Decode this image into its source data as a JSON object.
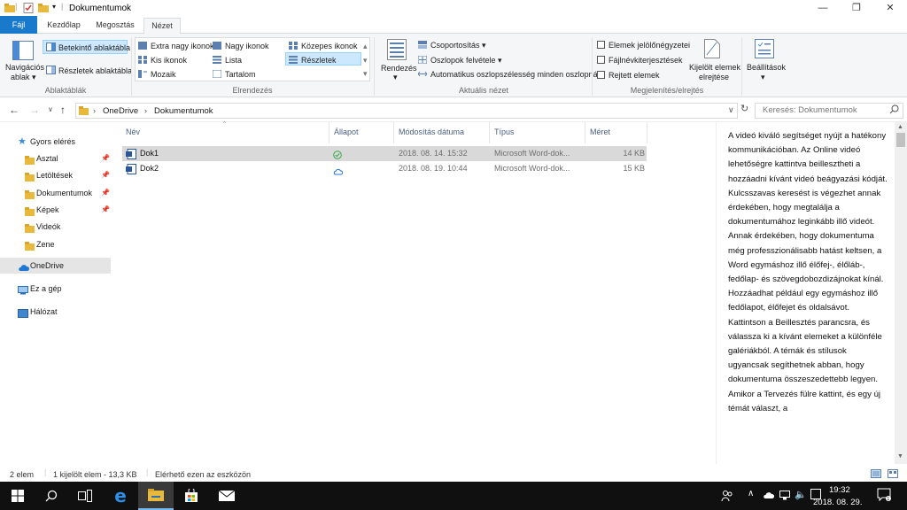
{
  "window": {
    "title": "Dokumentumok",
    "controls": [
      "—",
      "❐",
      "✕"
    ]
  },
  "ribbon_tabs": [
    {
      "label": "Fájl"
    },
    {
      "label": "Kezdőlap"
    },
    {
      "label": "Megosztás"
    },
    {
      "label": "Nézet"
    }
  ],
  "ribbon": {
    "panes": {
      "nav_pane_label": "Navigációs",
      "nav_pane_label2": "ablak",
      "preview_pane": "Betekintő ablaktábla",
      "details_pane": "Részletek ablaktábla",
      "group_label": "Ablaktáblák"
    },
    "layout": {
      "items": [
        "Extra nagy ikonok",
        "Nagy ikonok",
        "Közepes ikonok",
        "Kis ikonok",
        "Lista",
        "Részletek",
        "Mozaik",
        "Tartalom"
      ],
      "group_label": "Elrendezés"
    },
    "current_view": {
      "sort": "Rendezés",
      "group_by": "Csoportosítás",
      "add_columns": "Oszlopok felvétele",
      "autosize": "Automatikus oszlopszélesség minden oszlopnál",
      "group_label": "Aktuális nézet"
    },
    "show_hide": {
      "checkboxes": "Elemek jelölőnégyzetei",
      "extensions": "Fájlnévkiterjesztések",
      "hidden": "Rejtett elemek",
      "hide_selected": "Kijelölt elemek",
      "hide_selected2": "elrejtése",
      "group_label": "Megjelenítés/elrejtés"
    },
    "options": "Beállítások"
  },
  "address": {
    "path": [
      "OneDrive",
      "Dokumentumok"
    ],
    "search_placeholder": "Keresés: Dokumentumok"
  },
  "nav": {
    "quick_access": "Gyors elérés",
    "items": [
      {
        "label": "Asztal",
        "pinned": true
      },
      {
        "label": "Letöltések",
        "pinned": true
      },
      {
        "label": "Dokumentumok",
        "pinned": true
      },
      {
        "label": "Képek",
        "pinned": true
      },
      {
        "label": "Videók",
        "pinned": false
      },
      {
        "label": "Zene",
        "pinned": false
      }
    ],
    "onedrive": "OneDrive",
    "this_pc": "Ez a gép",
    "network": "Hálózat"
  },
  "files": {
    "columns": [
      "Név",
      "Állapot",
      "Módosítás dátuma",
      "Típus",
      "Méret"
    ],
    "rows": [
      {
        "name": "Dok1",
        "date": "2018. 08. 14. 15:32",
        "type": "Microsoft Word-dok...",
        "size": "14 KB"
      },
      {
        "name": "Dok2",
        "date": "2018. 08. 19. 10:44",
        "type": "Microsoft Word-dok...",
        "size": "15 KB"
      }
    ]
  },
  "preview": {
    "text": "A videó kiváló segítséget nyújt a hatékony kommunikációban. Az Online videó lehetőségre kattintva beillesztheti a hozzáadni kívánt videó beágyazási kódját. Kulcsszavas keresést is végezhet annak érdekében, hogy megtalálja a dokumentumához leginkább illő videót. Annak érdekében, hogy dokumentuma még professzionálisabb hatást keltsen, a Word egymáshoz illő élőfej-, élőláb-, fedőlap- és szövegdobozdizájnokat kínál. Hozzáadhat például egy egymáshoz illő fedőlapot, élőfejet és oldalsávot. Kattintson a Beillesztés parancsra, és válassza ki a kívánt elemeket a különféle galériákból. A témák és stílusok ugyancsak segíthetnek abban, hogy dokumentuma összeszedettebb legyen. Amikor a Tervezés fülre kattint, és egy új témát választ, a"
  },
  "status": {
    "count": "2 elem",
    "selected": "1 kijelölt elem - 13,3 KB",
    "available": "Elérhető ezen az eszközön"
  },
  "taskbar": {
    "time": "19:32",
    "date": "2018. 08. 29."
  }
}
